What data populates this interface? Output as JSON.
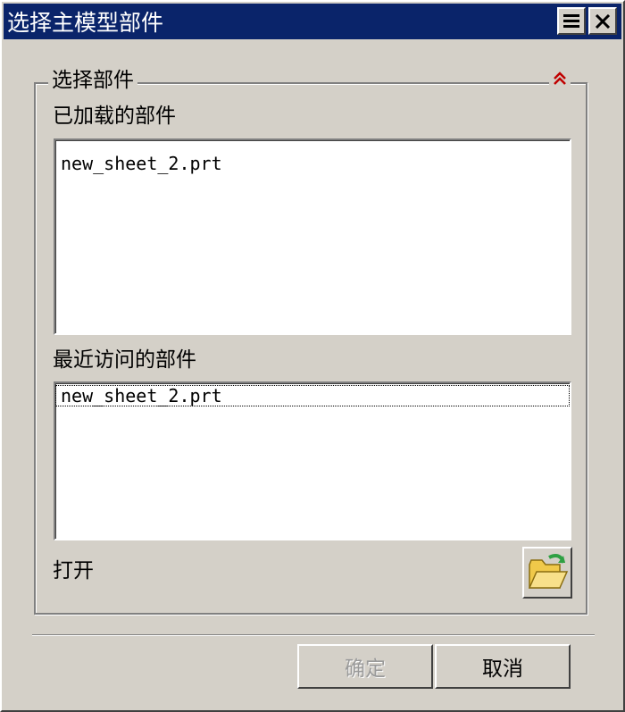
{
  "window": {
    "title": "选择主模型部件",
    "menu_icon": "menu-icon",
    "close_icon": "close-icon"
  },
  "group": {
    "title": "选择部件",
    "collapse_icon": "double-chevron-up-icon",
    "collapse_glyph": "≈"
  },
  "loaded_parts": {
    "label": "已加载的部件",
    "items": [
      "new_sheet_2.prt"
    ]
  },
  "recent_parts": {
    "label": "最近访问的部件",
    "items": [
      "new_sheet_2.prt"
    ]
  },
  "open": {
    "label": "打开",
    "icon": "open-folder-icon"
  },
  "buttons": {
    "ok_label": "确定",
    "ok_enabled": false,
    "cancel_label": "取消"
  },
  "colors": {
    "titlebar": "#0a246a",
    "face": "#d4d0c8",
    "collapse_icon": "#c00000",
    "folder": "#f5d76e",
    "folder_arrow": "#2ea043"
  }
}
